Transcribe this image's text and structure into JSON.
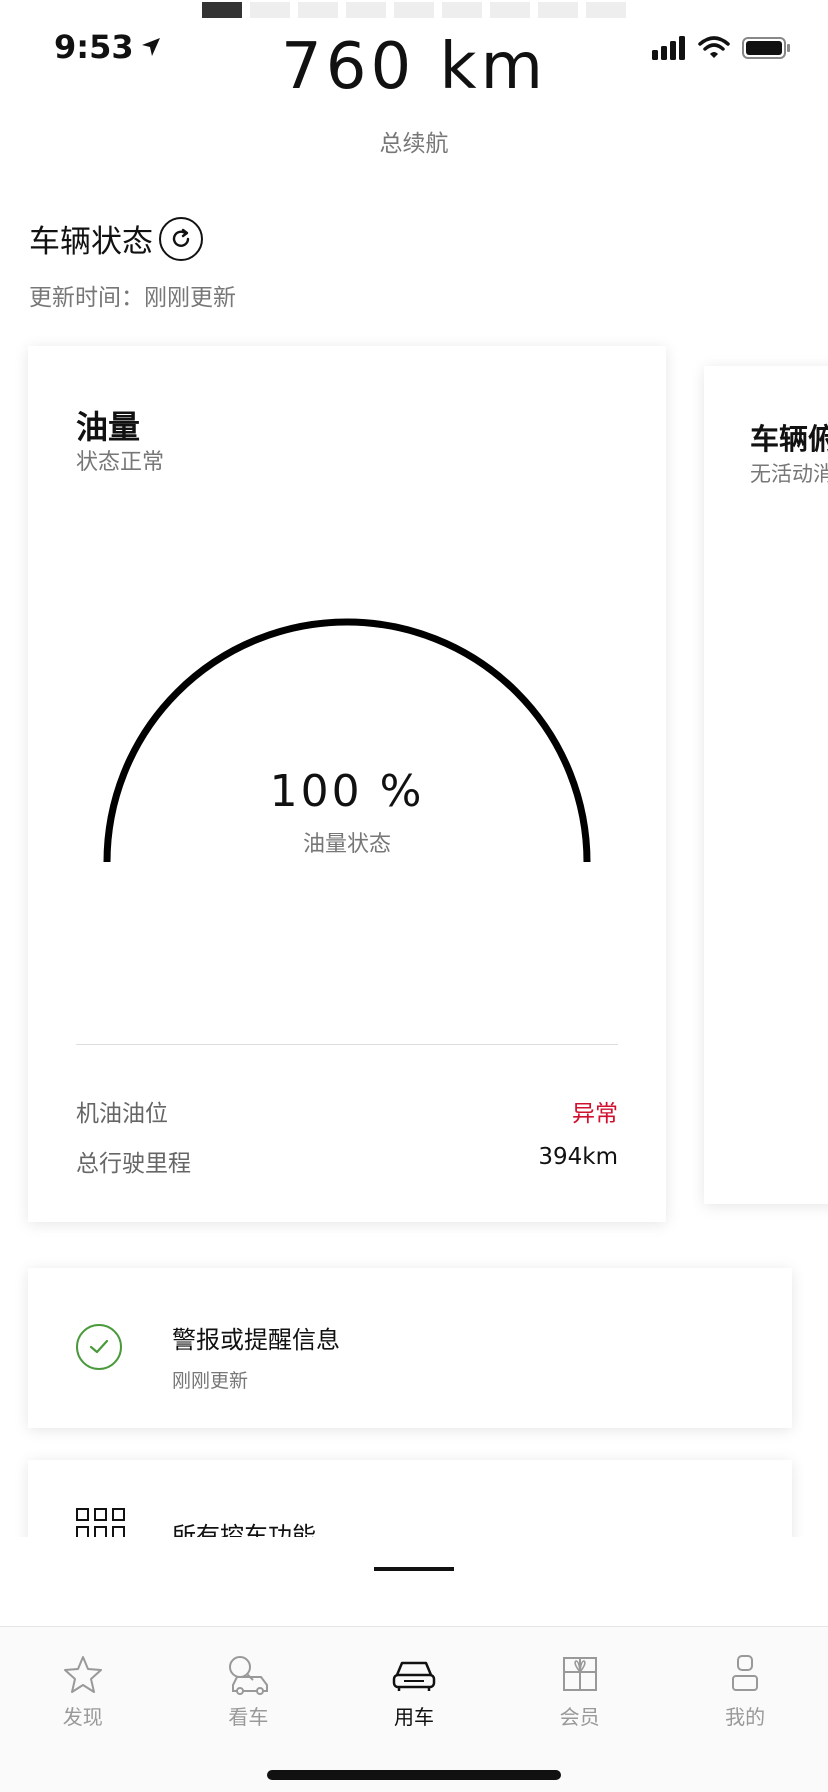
{
  "status_bar": {
    "time": "9:53"
  },
  "range": {
    "value": "760 km",
    "label": "总续航"
  },
  "vehicle_status": {
    "title": "车辆状态",
    "updated_label": "更新时间：",
    "updated_value": "刚刚更新"
  },
  "fuel_card": {
    "title": "油量",
    "subtitle": "状态正常",
    "gauge_value": "100 %",
    "gauge_label": "油量状态",
    "fuel_level_percent": 100,
    "rows": [
      {
        "label": "机油油位",
        "value": "异常"
      },
      {
        "label": "总行驶里程",
        "value": "394km"
      }
    ]
  },
  "side_card": {
    "title": "车辆俯",
    "subtitle": "无活动消"
  },
  "alert_card": {
    "title": "警报或提醒信息",
    "subtitle": "刚刚更新"
  },
  "functions_card": {
    "title": "所有控车功能"
  },
  "tabs": [
    {
      "label": "发现",
      "icon": "star-icon"
    },
    {
      "label": "看车",
      "icon": "car-search-icon"
    },
    {
      "label": "用车",
      "icon": "car-icon",
      "active": true
    },
    {
      "label": "会员",
      "icon": "gift-icon"
    },
    {
      "label": "我的",
      "icon": "person-icon"
    }
  ],
  "colors": {
    "alert": "#d0102e",
    "ok": "#4a9a3c",
    "active_tab": "#111111",
    "inactive_tab": "#999999"
  }
}
